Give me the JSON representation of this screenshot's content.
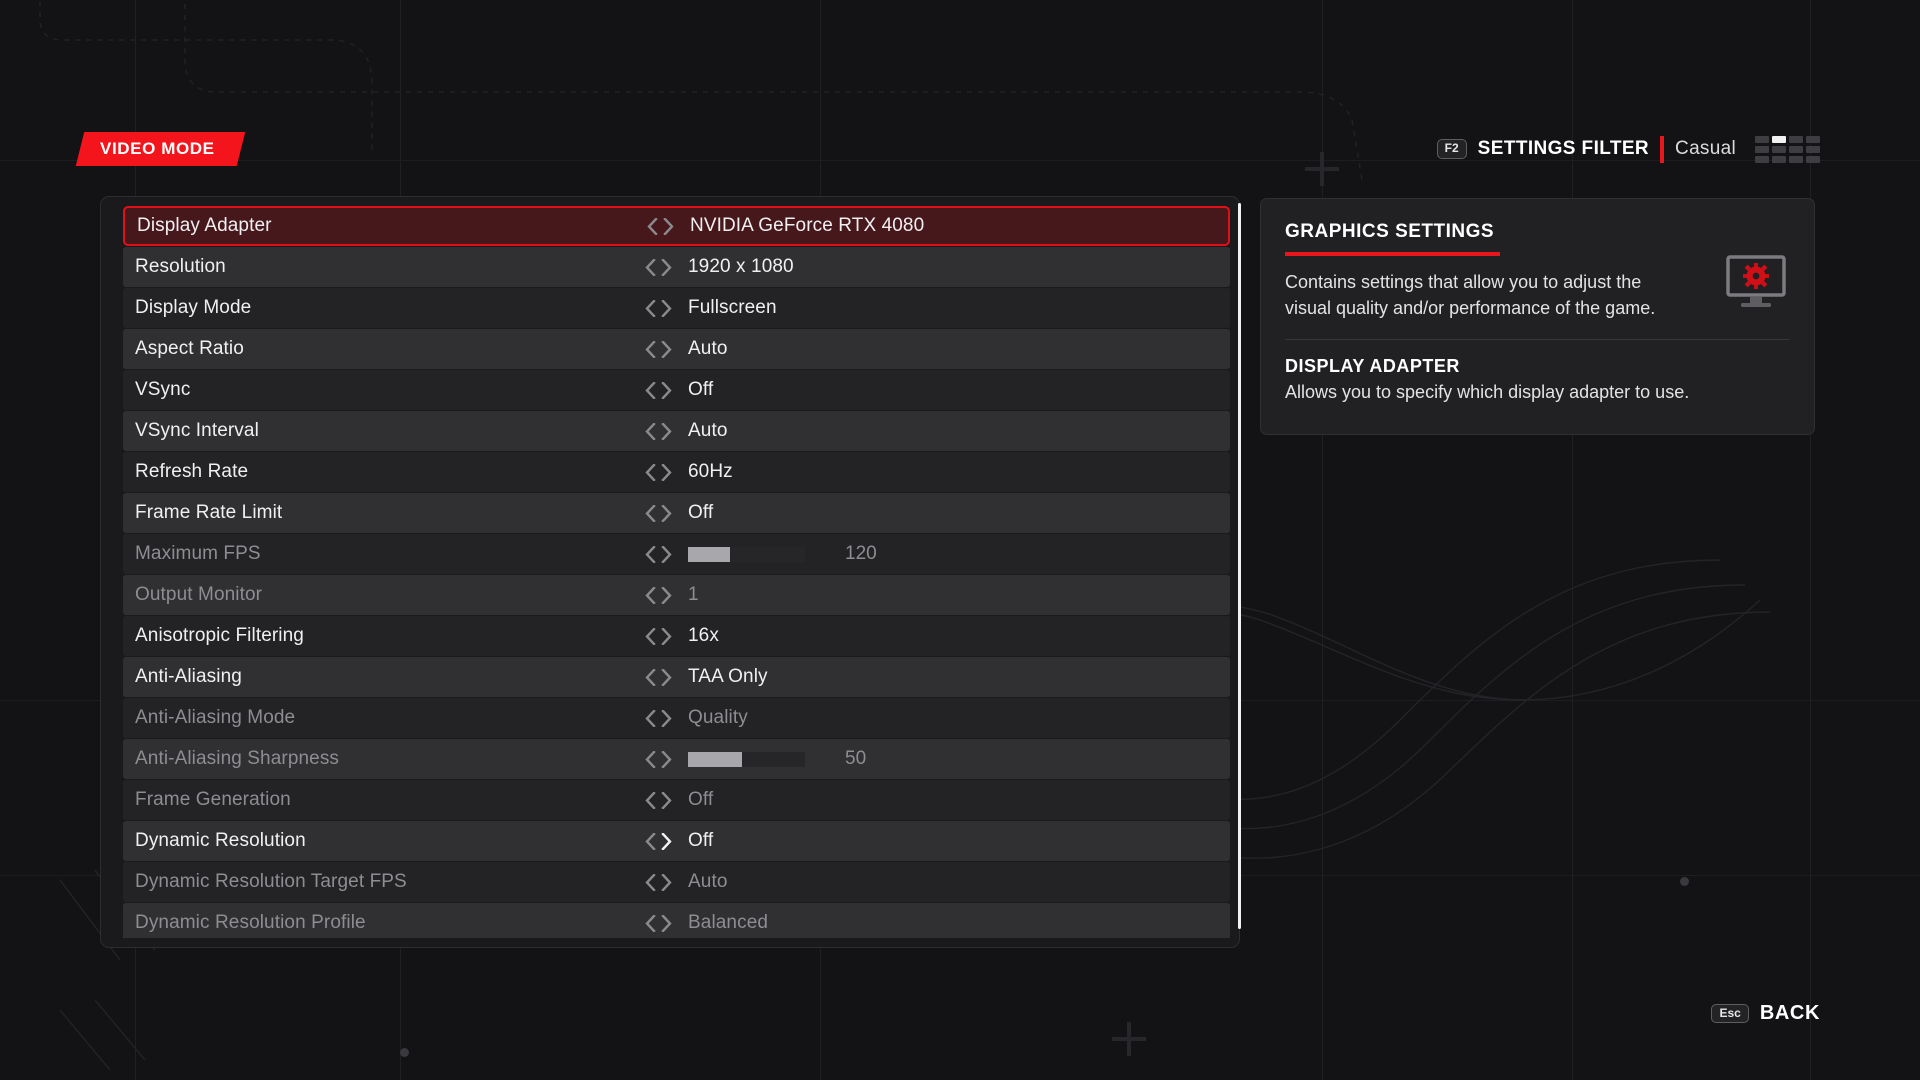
{
  "header": {
    "mode_tag": "VIDEO MODE",
    "filter_key": "F2",
    "filter_title": "SETTINGS FILTER",
    "filter_value": "Casual",
    "grid_icon": "settings-filter-grid-icon",
    "accent_red": "#e8161d",
    "tag_red": "#f4141b"
  },
  "settings": {
    "scrollbar": "list-scrollbar",
    "rows": [
      {
        "label": "Display Adapter",
        "value": "NVIDIA GeForce RTX 4080",
        "type": "option",
        "state": "selected"
      },
      {
        "label": "Resolution",
        "value": "1920 x 1080",
        "type": "option",
        "state": "enabled"
      },
      {
        "label": "Display Mode",
        "value": "Fullscreen",
        "type": "option",
        "state": "enabled"
      },
      {
        "label": "Aspect Ratio",
        "value": "Auto",
        "type": "option",
        "state": "enabled"
      },
      {
        "label": "VSync",
        "value": "Off",
        "type": "option",
        "state": "enabled"
      },
      {
        "label": "VSync Interval",
        "value": "Auto",
        "type": "option",
        "state": "enabled"
      },
      {
        "label": "Refresh Rate",
        "value": "60Hz",
        "type": "option",
        "state": "enabled"
      },
      {
        "label": "Frame Rate Limit",
        "value": "Off",
        "type": "option",
        "state": "enabled"
      },
      {
        "label": "Maximum FPS",
        "value": "120",
        "type": "slider",
        "fill_pct": 36,
        "state": "disabled"
      },
      {
        "label": "Output Monitor",
        "value": "1",
        "type": "option",
        "state": "disabled"
      },
      {
        "label": "Anisotropic Filtering",
        "value": "16x",
        "type": "option",
        "state": "enabled"
      },
      {
        "label": "Anti-Aliasing",
        "value": "TAA Only",
        "type": "option",
        "state": "enabled"
      },
      {
        "label": "Anti-Aliasing Mode",
        "value": "Quality",
        "type": "option",
        "state": "disabled"
      },
      {
        "label": "Anti-Aliasing Sharpness",
        "value": "50",
        "type": "slider",
        "fill_pct": 46,
        "state": "disabled"
      },
      {
        "label": "Frame Generation",
        "value": "Off",
        "type": "option",
        "state": "disabled"
      },
      {
        "label": "Dynamic Resolution",
        "value": "Off",
        "type": "option",
        "state": "enabled"
      },
      {
        "label": "Dynamic Resolution Target FPS",
        "value": "Auto",
        "type": "option",
        "state": "disabled"
      },
      {
        "label": "Dynamic Resolution Profile",
        "value": "Balanced",
        "type": "option",
        "state": "disabled"
      }
    ]
  },
  "info": {
    "heading": "GRAPHICS SETTINGS",
    "body": "Contains settings that allow you to adjust the visual quality and/or performance of the game.",
    "sub_heading": "DISPLAY ADAPTER",
    "sub_body": "Allows you to specify which display adapter to use.",
    "icon": "monitor-gear-icon"
  },
  "footer": {
    "back_key": "Esc",
    "back_label": "BACK"
  }
}
